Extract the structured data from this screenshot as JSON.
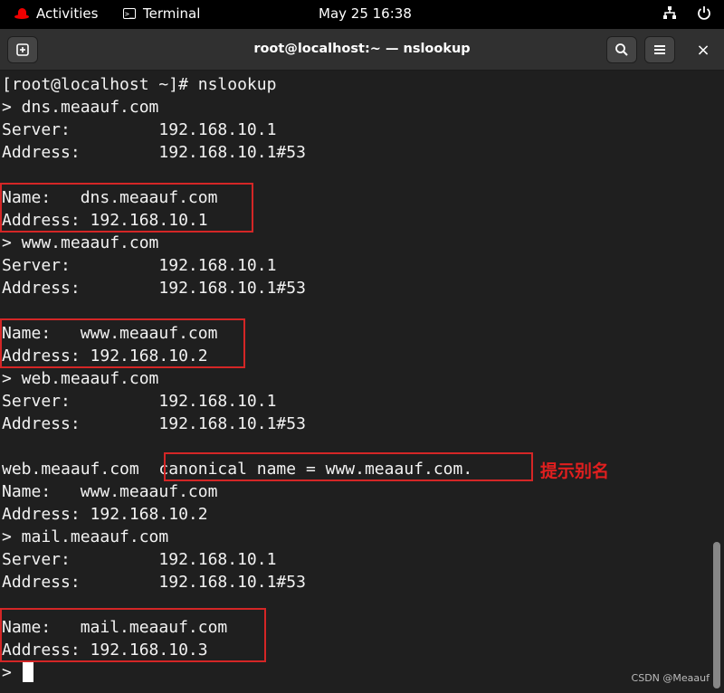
{
  "topbar": {
    "activities_label": "Activities",
    "app_label": "Terminal",
    "clock": "May 25  16:38"
  },
  "window": {
    "title": "root@localhost:~ — nslookup",
    "close_label": "×"
  },
  "terminal": {
    "lines": [
      "[root@localhost ~]# nslookup",
      "> dns.meaauf.com",
      "Server:         192.168.10.1",
      "Address:        192.168.10.1#53",
      "",
      "Name:   dns.meaauf.com",
      "Address: 192.168.10.1",
      "> www.meaauf.com",
      "Server:         192.168.10.1",
      "Address:        192.168.10.1#53",
      "",
      "Name:   www.meaauf.com",
      "Address: 192.168.10.2",
      "> web.meaauf.com",
      "Server:         192.168.10.1",
      "Address:        192.168.10.1#53",
      "",
      "web.meaauf.com  canonical name = www.meaauf.com.",
      "Name:   www.meaauf.com",
      "Address: 192.168.10.2",
      "> mail.meaauf.com",
      "Server:         192.168.10.1",
      "Address:        192.168.10.1#53",
      "",
      "Name:   mail.meaauf.com",
      "Address: 192.168.10.3",
      "> "
    ]
  },
  "annotation": {
    "label": "提示别名",
    "color": "#e11f1f"
  },
  "watermark": "CSDN @Meaauf",
  "colors": {
    "highlight_box": "#d42626",
    "terminal_bg": "#1f1f1f",
    "terminal_fg": "#f2f2f2"
  }
}
